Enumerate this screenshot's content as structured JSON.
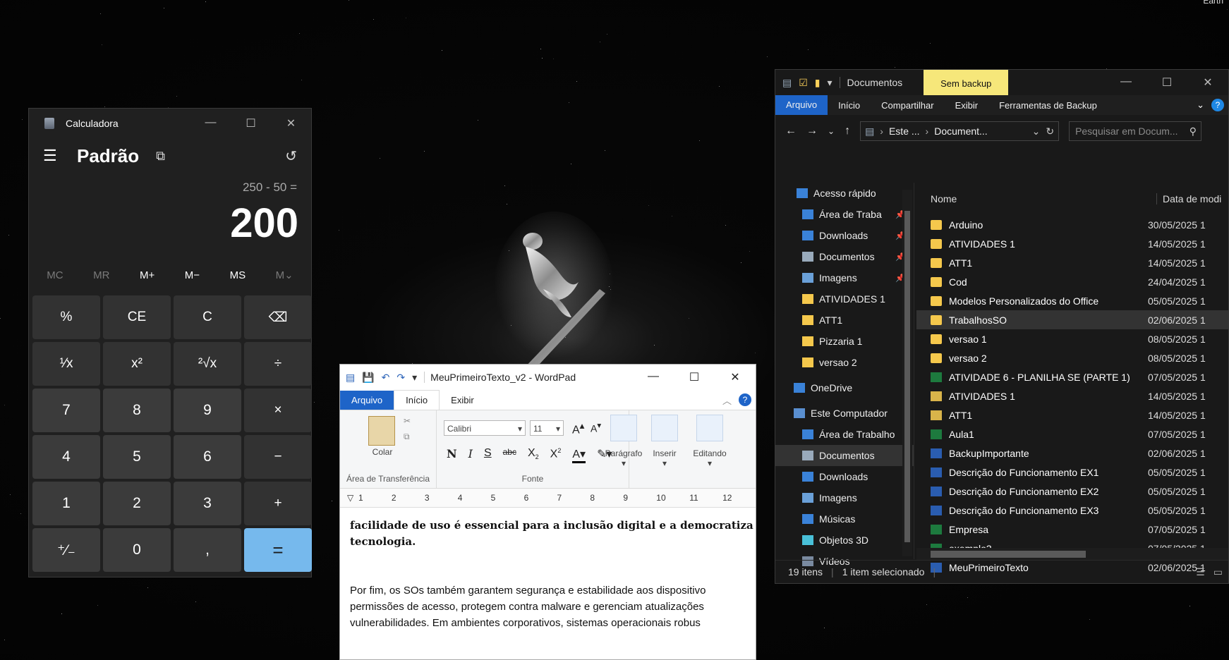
{
  "desktop": {
    "corner_label": "Earth"
  },
  "calculator": {
    "title": "Calculadora",
    "mode": "Padrão",
    "expression": "250 - 50 =",
    "display": "200",
    "memory_buttons": [
      "MC",
      "MR",
      "M+",
      "M−",
      "MS",
      "M⌄"
    ],
    "keys": [
      [
        "%",
        "CE",
        "C",
        "⌫"
      ],
      [
        "¹⁄x",
        "x²",
        "²√x",
        "÷"
      ],
      [
        "7",
        "8",
        "9",
        "×"
      ],
      [
        "4",
        "5",
        "6",
        "−"
      ],
      [
        "1",
        "2",
        "3",
        "+"
      ],
      [
        "⁺⁄₋",
        "0",
        ",",
        "="
      ]
    ]
  },
  "wordpad": {
    "title": "MeuPrimeiroTexto_v2 - WordPad",
    "tabs": [
      "Arquivo",
      "Início",
      "Exibir"
    ],
    "clipboard": {
      "paste_label": "Colar",
      "group_label": "Área de Transferência"
    },
    "font": {
      "family": "Calibri",
      "size": "11",
      "group_label": "Fonte"
    },
    "paragraph_label": "Parágrafo",
    "insert_label": "Inserir",
    "editing_label": "Editando",
    "ruler_numbers": [
      "1",
      "2",
      "3",
      "4",
      "5",
      "6",
      "7",
      "8",
      "9",
      "10",
      "11",
      "12"
    ],
    "document": {
      "bold_line1": "facilidade de uso é essencial para a inclusão digital e a democratiza",
      "bold_line2": "tecnologia.",
      "para_line1": "Por fim, os SOs também garantem segurança e estabilidade aos dispositivo",
      "para_line2": "permissões de acesso, protegem contra malware e gerenciam atualizações",
      "para_line3": "vulnerabilidades. Em ambientes corporativos, sistemas operacionais robus"
    }
  },
  "explorer": {
    "title": "Documentos",
    "badge": "Sem backup",
    "menu": [
      "Arquivo",
      "Início",
      "Compartilhar",
      "Exibir",
      "Ferramentas de Backup"
    ],
    "path": [
      "Este ...",
      "Document..."
    ],
    "search_placeholder": "Pesquisar em Docum...",
    "nav": {
      "quick_access": "Acesso rápido",
      "quick_items": [
        {
          "label": "Área de Traba",
          "pinned": true
        },
        {
          "label": "Downloads",
          "pinned": true
        },
        {
          "label": "Documentos",
          "pinned": true
        },
        {
          "label": "Imagens",
          "pinned": true
        },
        {
          "label": "ATIVIDADES 1",
          "pinned": false
        },
        {
          "label": "ATT1",
          "pinned": false
        },
        {
          "label": "Pizzaria 1",
          "pinned": false
        },
        {
          "label": "versao 2",
          "pinned": false
        }
      ],
      "onedrive": "OneDrive",
      "this_pc": "Este Computador",
      "pc_items": [
        "Área de Trabalho",
        "Documentos",
        "Downloads",
        "Imagens",
        "Músicas",
        "Objetos 3D",
        "Vídeos"
      ]
    },
    "columns": {
      "name": "Nome",
      "date": "Data de modi"
    },
    "files": [
      {
        "name": "Arduino",
        "date": "30/05/2025 1",
        "type": "folder"
      },
      {
        "name": "ATIVIDADES 1",
        "date": "14/05/2025 1",
        "type": "folder"
      },
      {
        "name": "ATT1",
        "date": "14/05/2025 1",
        "type": "folder"
      },
      {
        "name": "Cod",
        "date": "24/04/2025 1",
        "type": "folder"
      },
      {
        "name": "Modelos Personalizados do Office",
        "date": "05/05/2025 1",
        "type": "folder"
      },
      {
        "name": "TrabalhosSO",
        "date": "02/06/2025 1",
        "type": "folder"
      },
      {
        "name": "versao 1",
        "date": "08/05/2025 1",
        "type": "folder"
      },
      {
        "name": "versao 2",
        "date": "08/05/2025 1",
        "type": "folder"
      },
      {
        "name": "ATIVIDADE 6 - PLANILHA SE (PARTE 1)",
        "date": "07/05/2025 1",
        "type": "excel"
      },
      {
        "name": "ATIVIDADES 1",
        "date": "14/05/2025 1",
        "type": "zip"
      },
      {
        "name": "ATT1",
        "date": "14/05/2025 1",
        "type": "zip"
      },
      {
        "name": "Aula1",
        "date": "07/05/2025 1",
        "type": "excel"
      },
      {
        "name": "BackupImportante",
        "date": "02/06/2025 1",
        "type": "word"
      },
      {
        "name": "Descrição do Funcionamento EX1",
        "date": "05/05/2025 1",
        "type": "word"
      },
      {
        "name": "Descrição do Funcionamento EX2",
        "date": "05/05/2025 1",
        "type": "word"
      },
      {
        "name": "Descrição do Funcionamento EX3",
        "date": "05/05/2025 1",
        "type": "word"
      },
      {
        "name": "Empresa",
        "date": "07/05/2025 1",
        "type": "excel"
      },
      {
        "name": "exemplo3",
        "date": "07/05/2025 1",
        "type": "excel"
      },
      {
        "name": "MeuPrimeiroTexto",
        "date": "02/06/2025 1",
        "type": "word"
      }
    ],
    "selected_file": "TrabalhosSO",
    "status": {
      "count": "19 itens",
      "selected": "1 item selecionado"
    }
  }
}
